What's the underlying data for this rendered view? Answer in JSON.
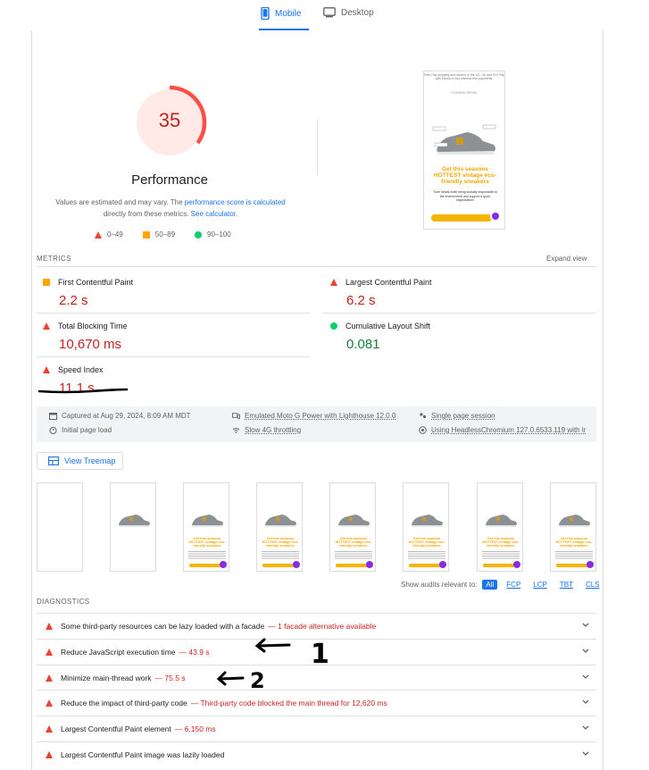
{
  "tabs": {
    "mobile": "Mobile",
    "desktop": "Desktop"
  },
  "gauge": {
    "score": "35",
    "fraction": 0.35,
    "color": "#ff4e42",
    "fill_color": "#ffeae8"
  },
  "performance": {
    "title": "Performance",
    "note_prefix": "Values are estimated and may vary. The ",
    "note_link1": "performance score is calculated",
    "note_mid": " directly from these metrics. ",
    "note_link2": "See calculator."
  },
  "legend": {
    "fail": "0–49",
    "average": "50–89",
    "pass": "90–100"
  },
  "phone_preview": {
    "topbar": "Free Day shipping and returns in the US, UK and EU! Pay with Klarna in four interest-free payments.",
    "logo": "COMMON SENSE",
    "headline": "Get this seasons HOTTEST vintage eco-friendly sneakers",
    "body": "Tune heads while being socially responsible to the environment and support a good organization!"
  },
  "metrics": {
    "header": "METRICS",
    "expand": "Expand view",
    "items": [
      {
        "label": "First Contentful Paint",
        "value": "2.2 s",
        "status": "average"
      },
      {
        "label": "Largest Contentful Paint",
        "value": "6.2 s",
        "status": "fail"
      },
      {
        "label": "Total Blocking Time",
        "value": "10,670 ms",
        "status": "fail"
      },
      {
        "label": "Cumulative Layout Shift",
        "value": "0.081",
        "status": "pass"
      },
      {
        "label": "Speed Index",
        "value": "11.1 s",
        "status": "fail"
      }
    ]
  },
  "info": {
    "captured": "Captured at Aug 29, 2024, 8:09 AM MDT",
    "initial_load": "Initial page load",
    "device": "Emulated Moto G Power with Lighthouse 12.0.0",
    "throttling": "Slow 4G throttling",
    "session": "Single page session",
    "browser": "Using HeadlessChromium 127.0.6533.119 with lr"
  },
  "treemap": {
    "label": "View Treemap"
  },
  "filmstrip": {
    "frame_headline": "Get this seasons HOTTEST vintage eco-friendly sneakers",
    "frame_count": 8
  },
  "audit_filter": {
    "label": "Show audits relevant to:",
    "chips": [
      "All",
      "FCP",
      "LCP",
      "TBT",
      "CLS"
    ]
  },
  "diagnostics": {
    "header": "DIAGNOSTICS",
    "items": [
      {
        "text": "Some third-party resources can be lazy loaded with a facade",
        "value": "— 1 facade alternative available"
      },
      {
        "text": "Reduce JavaScript execution time",
        "value": "— 43.9 s"
      },
      {
        "text": "Minimize main-thread work",
        "value": "— 75.5 s"
      },
      {
        "text": "Reduce the impact of third-party code",
        "value": "— Third-party code blocked the main thread for 12,620 ms"
      },
      {
        "text": "Largest Contentful Paint element",
        "value": "— 6,150 ms"
      },
      {
        "text": "Largest Contentful Paint image was lazily loaded",
        "value": ""
      }
    ]
  },
  "annotations": {
    "arrow1_label": "1",
    "arrow2_label": "2"
  },
  "colors": {
    "fail": "#ea4335",
    "average": "#ffa400",
    "pass": "#0cce6b",
    "link": "#1a73e8"
  }
}
